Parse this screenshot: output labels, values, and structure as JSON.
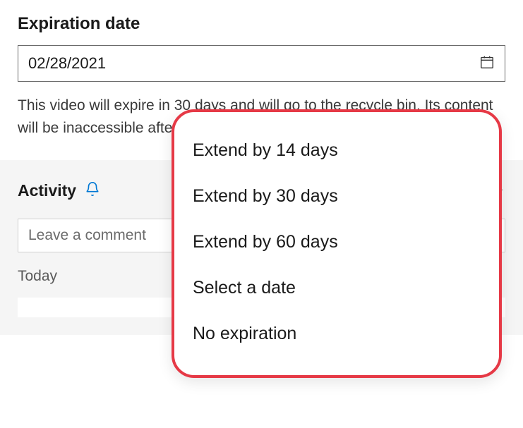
{
  "expiration": {
    "label": "Expiration date",
    "value": "02/28/2021",
    "helper": "This video will expire in 30 days and will go to the recycle bin. Its content will be inaccessible after that time."
  },
  "activity": {
    "title": "Activity",
    "comment_placeholder": "Leave a comment",
    "today_label": "Today"
  },
  "dropdown": {
    "items": [
      "Extend by 14 days",
      "Extend by 30 days",
      "Extend by 60 days",
      "Select a date",
      "No expiration"
    ]
  }
}
